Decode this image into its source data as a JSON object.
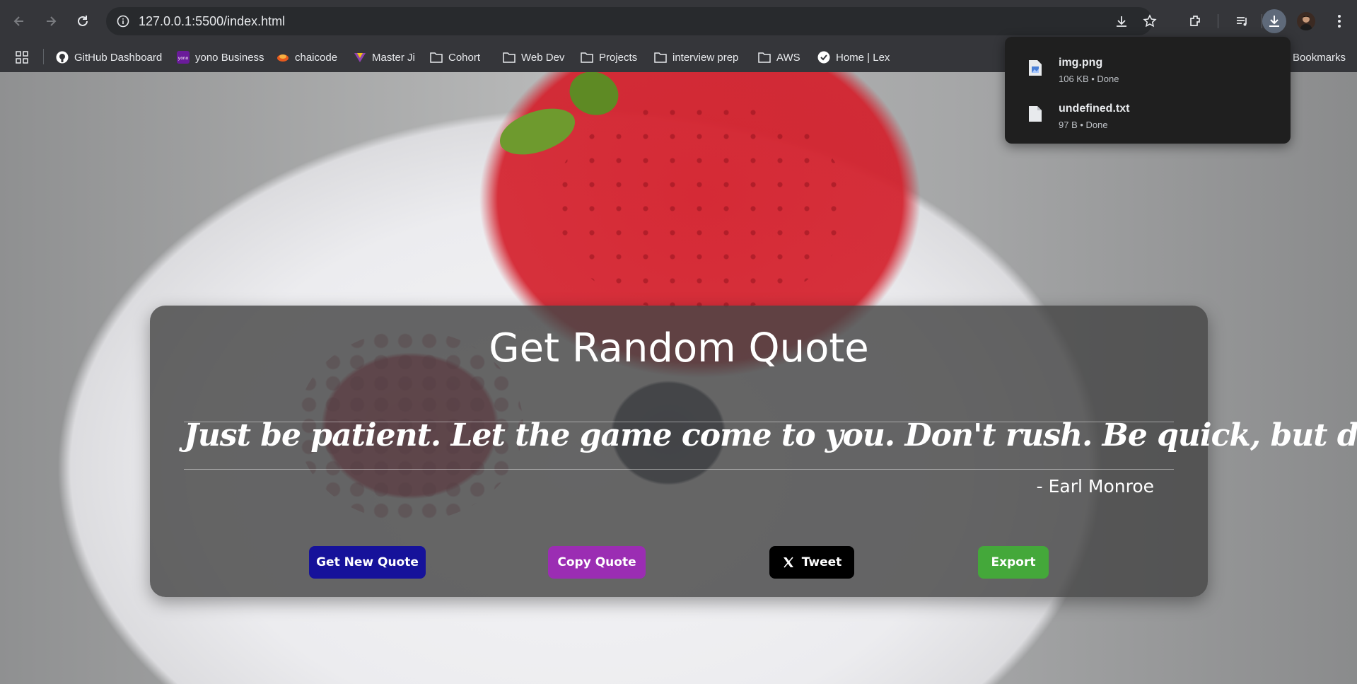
{
  "browser": {
    "url": "127.0.0.1:5500/index.html",
    "bookmarks": [
      {
        "label": "GitHub Dashboard",
        "icon": "github-icon"
      },
      {
        "label": "yono Business",
        "icon": "yono-icon"
      },
      {
        "label": "chaicode",
        "icon": "chaicode-icon"
      },
      {
        "label": "Master Ji",
        "icon": "masterji-icon"
      },
      {
        "label": "Cohort",
        "icon": "folder-icon"
      },
      {
        "label": "Web Dev",
        "icon": "folder-icon"
      },
      {
        "label": "Projects",
        "icon": "folder-icon"
      },
      {
        "label": "interview prep",
        "icon": "folder-icon"
      },
      {
        "label": "AWS",
        "icon": "folder-icon"
      },
      {
        "label": "Home | Lex",
        "icon": "lex-icon"
      }
    ],
    "all_bookmarks_label": "Bookmarks"
  },
  "downloads": {
    "items": [
      {
        "name": "img.png",
        "status": "106 KB • Done",
        "icon": "image-file-icon"
      },
      {
        "name": "undefined.txt",
        "status": "97 B • Done",
        "icon": "text-file-icon"
      }
    ]
  },
  "app": {
    "title": "Get Random Quote",
    "quote": "Just be patient. Let the game come to you. Don't rush. Be quick, but don't hurry.",
    "author": "- Earl Monroe",
    "buttons": {
      "new_quote": "Get New Quote",
      "copy_quote": "Copy Quote",
      "tweet": "Tweet",
      "export": "Export"
    }
  },
  "colors": {
    "new_quote_bg": "#16129a",
    "copy_quote_bg": "#9b2db3",
    "tweet_bg": "#000000",
    "export_bg": "#44a83a",
    "card_bg": "#464646"
  }
}
